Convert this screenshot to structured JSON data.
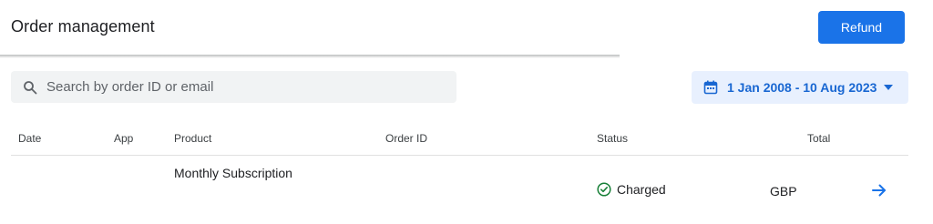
{
  "header": {
    "title": "Order management",
    "refund_label": "Refund"
  },
  "toolbar": {
    "search_placeholder": "Search by order ID or email",
    "date_range": "1 Jan 2008 - 10 Aug 2023"
  },
  "table": {
    "columns": [
      "Date",
      "App",
      "Product",
      "Order ID",
      "Status",
      "Total"
    ],
    "rows": [
      {
        "date": "",
        "app": "",
        "product": "Monthly Subscription",
        "order_id": "",
        "status": "Charged",
        "total": "GBP"
      }
    ]
  },
  "colors": {
    "accent": "#1a73e8",
    "status_ok": "#188038",
    "date_bg": "#e8f0fe"
  },
  "icons": [
    "search-icon",
    "calendar-icon",
    "chevron-down-icon",
    "check-circle-icon",
    "arrow-right-icon"
  ]
}
